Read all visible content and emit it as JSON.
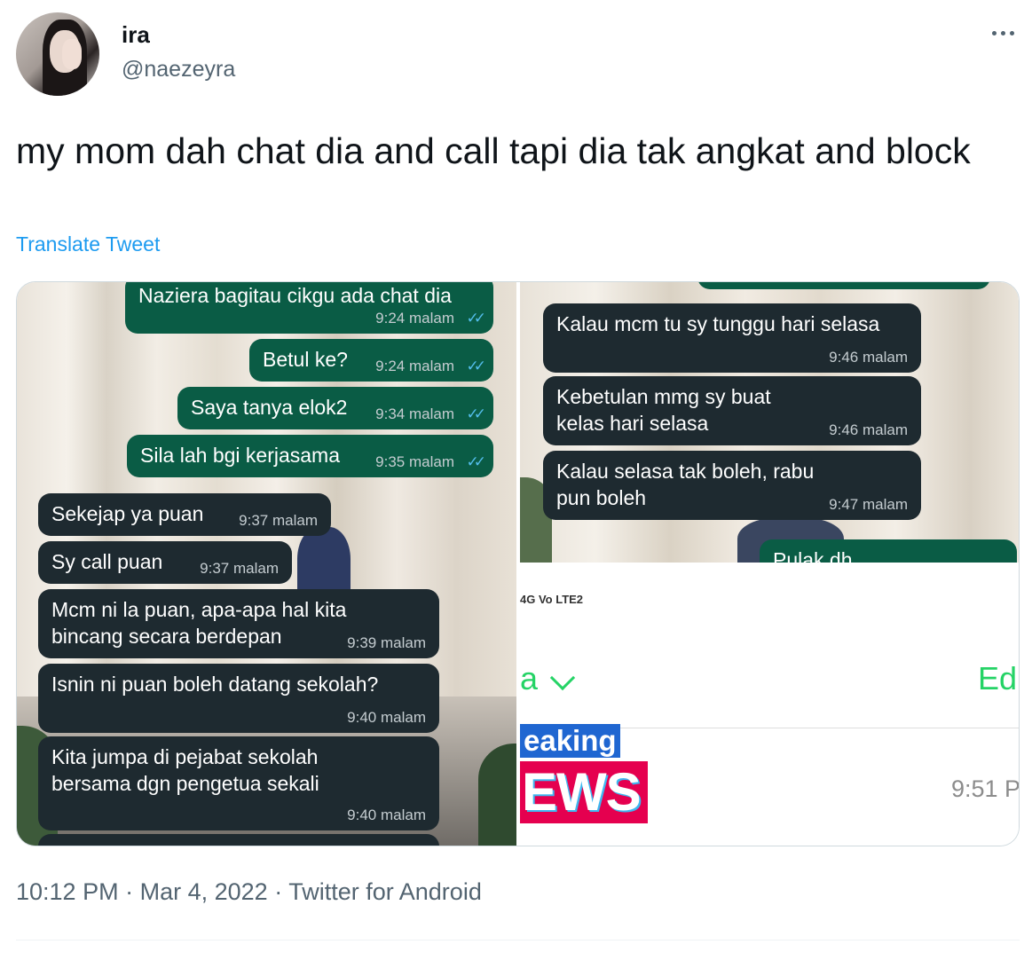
{
  "tweet": {
    "display_name": "ira",
    "handle": "@naezeyra",
    "text": "my mom dah chat dia and call tapi dia tak angkat and block",
    "translate_label": "Translate Tweet",
    "timestamp": "10:12 PM",
    "date": "Mar 4, 2022",
    "source": "Twitter for Android",
    "separator": "·"
  },
  "left_chat": [
    {
      "text": "Naziera bagitau cikgu ada chat dia",
      "time": "9:24 malam",
      "dir": "out",
      "ticks": "✓✓"
    },
    {
      "text": "Betul ke?",
      "time": "9:24 malam",
      "dir": "out",
      "ticks": "✓✓"
    },
    {
      "text": "Saya tanya elok2",
      "time": "9:34 malam",
      "dir": "out",
      "ticks": "✓✓"
    },
    {
      "text": "Sila lah bgi kerjasama",
      "time": "9:35 malam",
      "dir": "out",
      "ticks": "✓✓"
    },
    {
      "text": "Sekejap ya puan",
      "time": "9:37 malam",
      "dir": "in"
    },
    {
      "text": "Sy call puan",
      "time": "9:37 malam",
      "dir": "in"
    },
    {
      "text": "Mcm ni la puan, apa-apa hal kita bincang secara berdepan",
      "time": "9:39 malam",
      "dir": "in"
    },
    {
      "text": "Isnin ni puan boleh datang sekolah?",
      "time": "9:40 malam",
      "dir": "in"
    },
    {
      "text": "Kita jumpa di pejabat sekolah bersama dgn pengetua sekali",
      "time": "9:40 malam",
      "dir": "in"
    }
  ],
  "right_chat": [
    {
      "text": "Kalau mcm tu sy tunggu hari selasa",
      "time": "9:46 malam",
      "dir": "in"
    },
    {
      "text": "Kebetulan mmg sy buat kelas hari selasa",
      "time": "9:46 malam",
      "dir": "in"
    },
    {
      "text": "Kalau selasa tak boleh, rabu pun boleh",
      "time": "9:47 malam",
      "dir": "in"
    },
    {
      "text": "Pulak dh",
      "dir": "out"
    }
  ],
  "right_screen": {
    "status_text": "4G Vo LTE2",
    "contact_fragment": "a",
    "edit_fragment": "Ed",
    "breaking_fragment": "eaking",
    "news_fragment": "EWS",
    "time_fragment": "9:51 P"
  },
  "colors": {
    "outgoing_bubble": "#0a5c45",
    "incoming_bubble": "#1e2a30",
    "link": "#1d9bf0",
    "whatsapp_green": "#25d366"
  }
}
